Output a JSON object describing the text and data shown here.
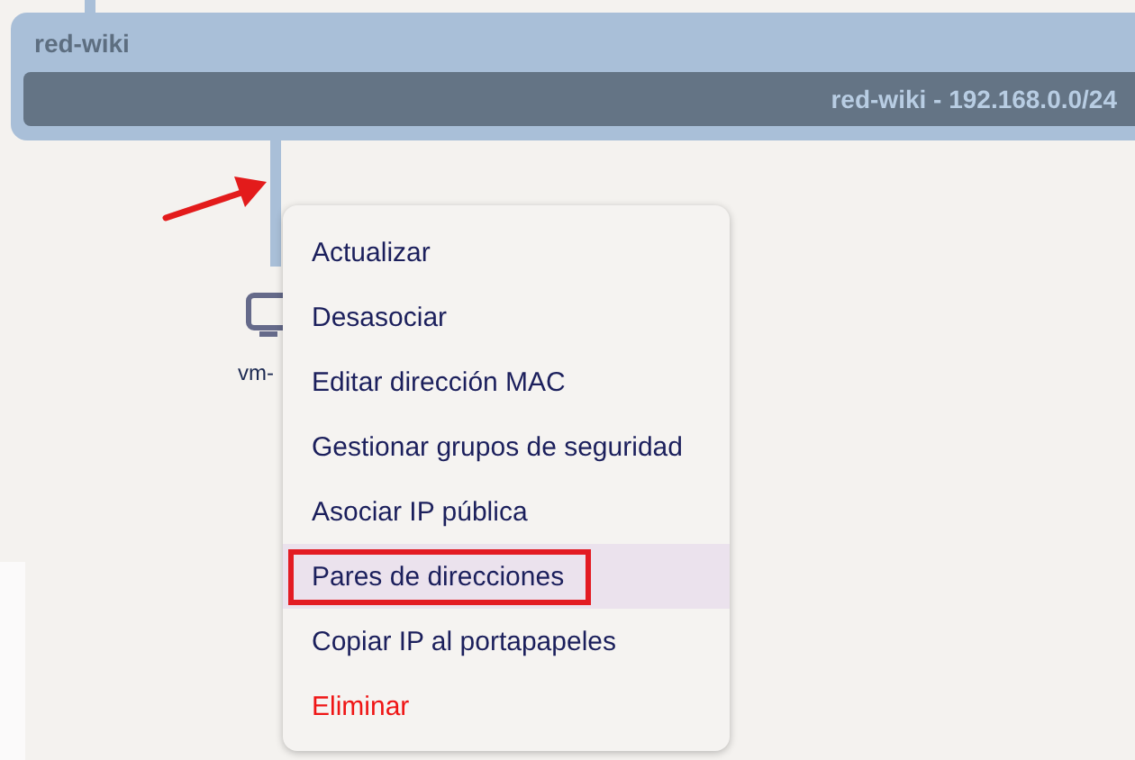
{
  "network": {
    "name": "red-wiki",
    "subnet_label": "red-wiki - 192.168.0.0/24"
  },
  "vm": {
    "label": "vm-"
  },
  "context_menu": {
    "items": [
      {
        "label": "Actualizar",
        "kind": "normal",
        "selected": false,
        "annotated": false
      },
      {
        "label": "Desasociar",
        "kind": "normal",
        "selected": false,
        "annotated": false
      },
      {
        "label": "Editar dirección MAC",
        "kind": "normal",
        "selected": false,
        "annotated": false
      },
      {
        "label": "Gestionar grupos de seguridad",
        "kind": "normal",
        "selected": false,
        "annotated": false
      },
      {
        "label": "Asociar IP pública",
        "kind": "normal",
        "selected": false,
        "annotated": false
      },
      {
        "label": "Pares de direcciones",
        "kind": "normal",
        "selected": true,
        "annotated": true
      },
      {
        "label": "Copiar IP al portapapeles",
        "kind": "normal",
        "selected": false,
        "annotated": false
      },
      {
        "label": "Eliminar",
        "kind": "danger",
        "selected": false,
        "annotated": false
      }
    ]
  }
}
